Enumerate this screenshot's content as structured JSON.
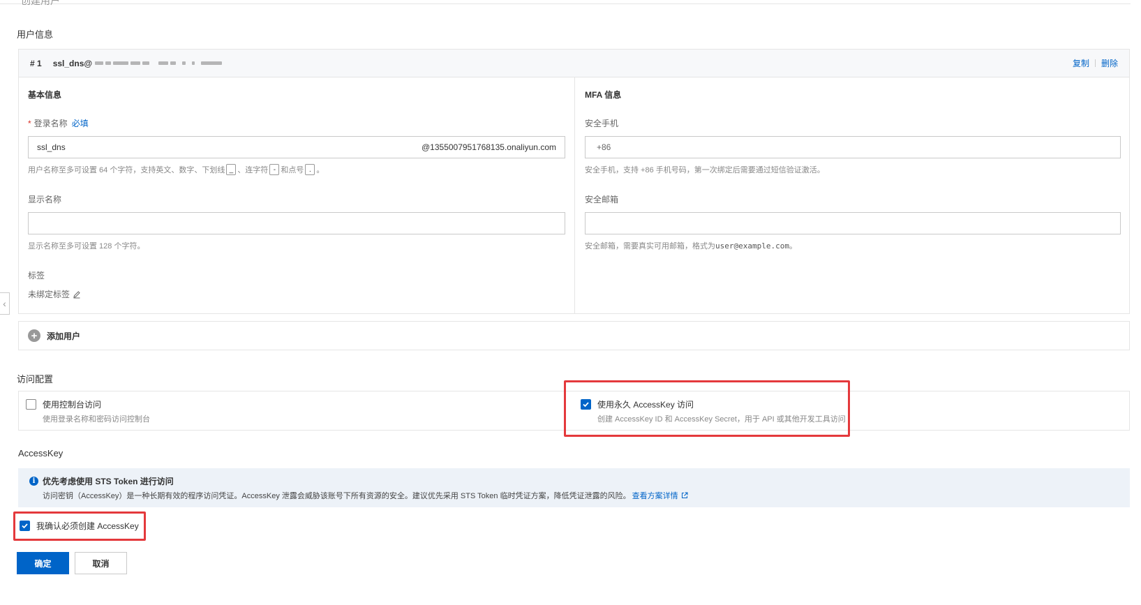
{
  "page": {
    "partial_title": "创建用户"
  },
  "user_info": {
    "section_title": "用户信息",
    "card": {
      "index": "# 1",
      "username": "ssl_dns@",
      "copy_label": "复制",
      "delete_label": "删除",
      "basic": {
        "title": "基本信息",
        "login_name_label": "登录名称",
        "login_name_required": "必填",
        "login_name_value": "ssl_dns",
        "login_name_suffix": "@1355007951768135.onaliyun.com",
        "login_name_hint_prefix": "用户名称至多可设置 64 个字符，支持英文、数字、下划线",
        "hint_underscore": "_",
        "hint_hyphen_text": "、连字符",
        "hint_hyphen": "-",
        "hint_dot_text": "和点号",
        "hint_dot": ".",
        "hint_end": "。",
        "display_name_label": "显示名称",
        "display_name_value": "",
        "display_name_hint": "显示名称至多可设置 128 个字符。",
        "tag_label": "标签",
        "tag_value": "未绑定标签"
      },
      "mfa": {
        "title": "MFA 信息",
        "phone_label": "安全手机",
        "phone_prefix": "+86",
        "phone_hint": "安全手机，支持 +86 手机号码，第一次绑定后需要通过短信验证激活。",
        "email_label": "安全邮箱",
        "email_value": "",
        "email_hint_prefix": "安全邮箱，需要真实可用邮箱，格式为 ",
        "email_hint_example": "user@example.com",
        "email_hint_end": "。"
      }
    },
    "add_user_label": "添加用户"
  },
  "access": {
    "section_title": "访问配置",
    "console": {
      "title": "使用控制台访问",
      "desc": "使用登录名称和密码访问控制台",
      "checked": false
    },
    "accesskey": {
      "title": "使用永久 AccessKey 访问",
      "desc": "创建 AccessKey ID 和 AccessKey Secret，用于 API 或其他开发工具访问",
      "checked": true
    }
  },
  "accesskey_section": {
    "title": "AccessKey",
    "alert_title": "优先考虑使用 STS Token 进行访问",
    "alert_body": "访问密钥（AccessKey）是一种长期有效的程序访问凭证。AccessKey 泄露会威胁该账号下所有资源的安全。建议优先采用 STS Token 临时凭证方案，降低凭证泄露的风险。",
    "alert_link": "查看方案详情",
    "confirm_label": "我确认必须创建 AccessKey",
    "confirm_checked": true
  },
  "buttons": {
    "ok": "确定",
    "cancel": "取消"
  },
  "colors": {
    "primary": "#0064c8",
    "highlight": "#e4393c",
    "alert_bg": "#edf2f8"
  }
}
